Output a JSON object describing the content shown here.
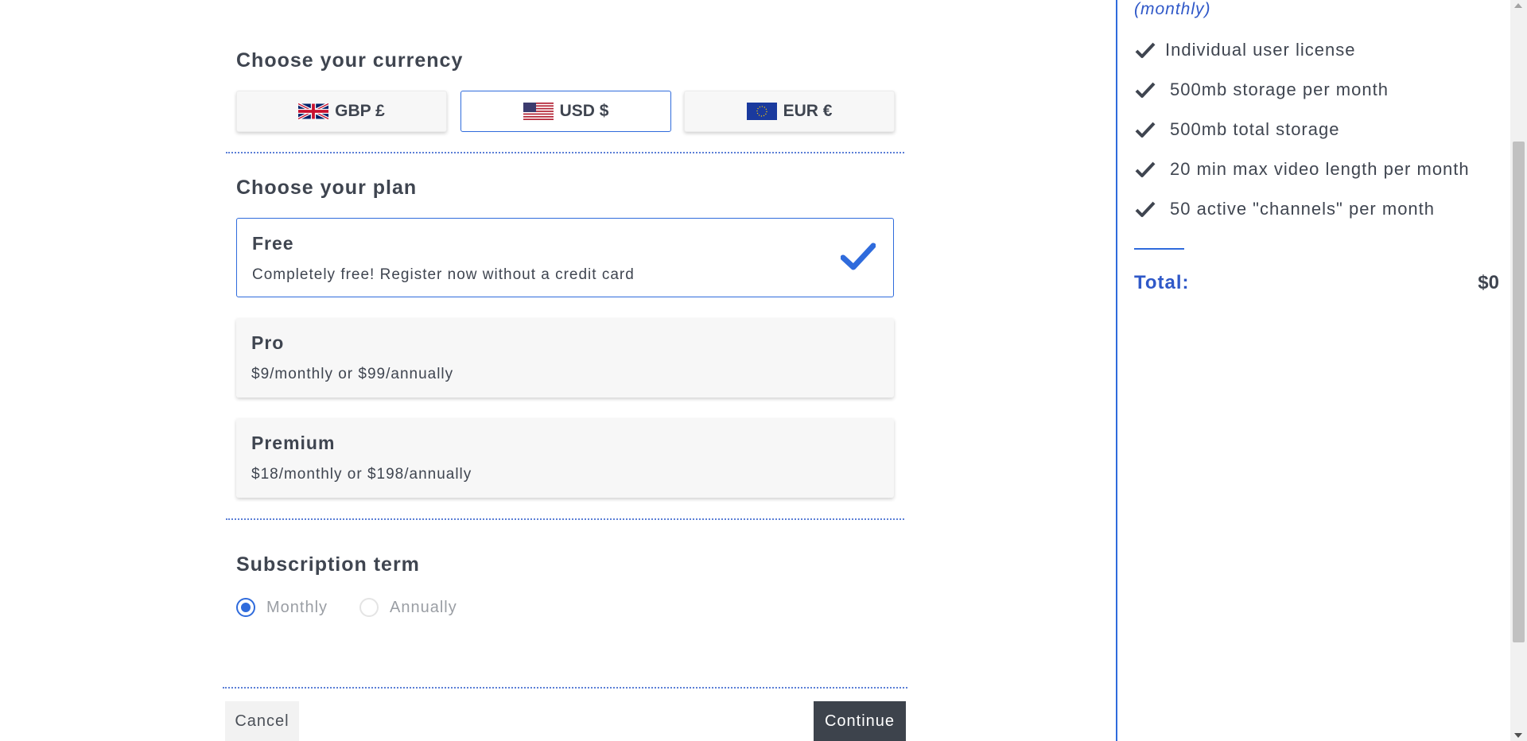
{
  "currency": {
    "title": "Choose your currency",
    "options": [
      {
        "label": "GBP £",
        "flag": "uk-flag-icon",
        "selected": false
      },
      {
        "label": "USD $",
        "flag": "us-flag-icon",
        "selected": true
      },
      {
        "label": "EUR €",
        "flag": "eu-flag-icon",
        "selected": false
      }
    ]
  },
  "plan": {
    "title": "Choose your plan",
    "options": [
      {
        "name": "Free",
        "description": "Completely free! Register now without a credit card",
        "selected": true
      },
      {
        "name": "Pro",
        "description": "$9/monthly or $99/annually",
        "selected": false
      },
      {
        "name": "Premium",
        "description": "$18/monthly or $198/annually",
        "selected": false
      }
    ]
  },
  "term": {
    "title": "Subscription term",
    "options": [
      {
        "label": "Monthly",
        "checked": true
      },
      {
        "label": "Annually",
        "checked": false
      }
    ]
  },
  "actions": {
    "cancel_label": "Cancel",
    "continue_label": "Continue"
  },
  "summary": {
    "term_label": "(monthly)",
    "features": [
      "Individual user license",
      "500mb storage per month",
      "500mb total storage",
      "20 min max video length per month",
      "50 active \"channels\" per month"
    ],
    "total_label": "Total:",
    "total_value": "$0"
  },
  "colors": {
    "accent": "#2f6bdc",
    "text": "#3f4550",
    "primary_button": "#3d434c"
  }
}
